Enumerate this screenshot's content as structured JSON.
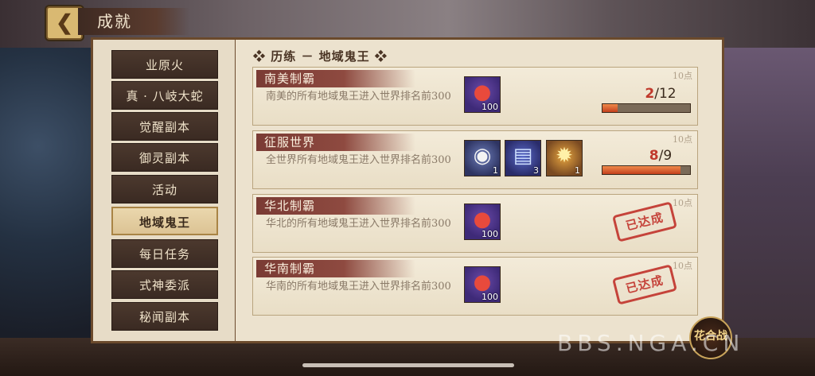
{
  "header": {
    "back_icon": "back-arrow-icon",
    "title": "成就"
  },
  "sidebar": {
    "items": [
      {
        "label": "业原火"
      },
      {
        "label": "真 · 八岐大蛇"
      },
      {
        "label": "觉醒副本"
      },
      {
        "label": "御灵副本"
      },
      {
        "label": "活动"
      },
      {
        "label": "地域鬼王",
        "active": true
      },
      {
        "label": "每日任务"
      },
      {
        "label": "式神委派"
      },
      {
        "label": "秘闻副本"
      }
    ]
  },
  "section": {
    "title": "❖ 历练 － 地域鬼王 ❖"
  },
  "achievements": [
    {
      "name": "南美制霸",
      "desc": "南美的所有地域鬼王进入世界排名前300",
      "points": "10点",
      "rewards": [
        {
          "icon": "red-magatama-icon",
          "qty": "100"
        }
      ],
      "progress_current": "2",
      "progress_total": "/12",
      "progress_fraction": 0.17
    },
    {
      "name": "征服世界",
      "desc": "全世界所有地域鬼王进入世界排名前300",
      "points": "10点",
      "rewards": [
        {
          "icon": "daruma-mask-icon",
          "qty": "1"
        },
        {
          "icon": "blue-ticket-icon",
          "qty": "3"
        },
        {
          "icon": "fire-orb-icon",
          "qty": "1"
        }
      ],
      "progress_current": "8",
      "progress_total": "/9",
      "progress_fraction": 0.89
    },
    {
      "name": "华北制霸",
      "desc": "华北的所有地域鬼王进入世界排名前300",
      "points": "10点",
      "rewards": [
        {
          "icon": "red-magatama-icon",
          "qty": "100"
        }
      ],
      "stamp": "已达成"
    },
    {
      "name": "华南制霸",
      "desc": "华南的所有地域鬼王进入世界排名前300",
      "points": "10点",
      "rewards": [
        {
          "icon": "red-magatama-icon",
          "qty": "100"
        }
      ],
      "stamp": "已达成"
    }
  ],
  "badge": {
    "label": "花合战"
  },
  "watermark": "BBS.NGA.CN"
}
